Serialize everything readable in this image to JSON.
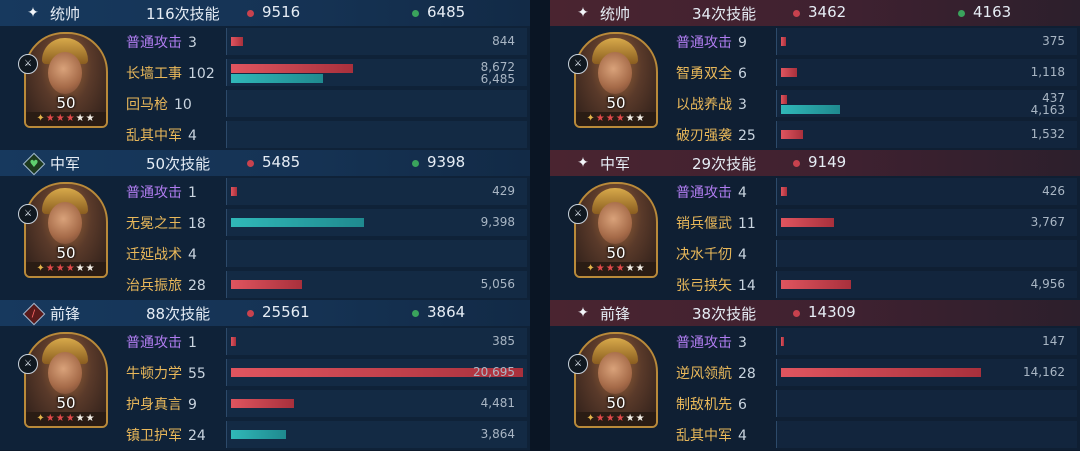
{
  "left": {
    "groups": [
      {
        "role": "统帅",
        "role_icon": "sparkle-icon",
        "casts": "116次技能",
        "damage": "9516",
        "heal": "6485",
        "level": "50",
        "skills": [
          {
            "name": "普通攻击",
            "count": "3",
            "damage": 844,
            "heal": null,
            "damage_label": "844",
            "heal_label": ""
          },
          {
            "name": "长墙工事",
            "count": "102",
            "damage": 8672,
            "heal": 6485,
            "damage_label": "8,672",
            "heal_label": "6,485"
          },
          {
            "name": "回马枪",
            "count": "10",
            "damage": null,
            "heal": null,
            "damage_label": "",
            "heal_label": ""
          },
          {
            "name": "乱其中军",
            "count": "4",
            "damage": null,
            "heal": null,
            "damage_label": "",
            "heal_label": ""
          }
        ]
      },
      {
        "role": "中军",
        "role_icon": "heart-shield-icon",
        "casts": "50次技能",
        "damage": "5485",
        "heal": "9398",
        "level": "50",
        "skills": [
          {
            "name": "普通攻击",
            "count": "1",
            "damage": 429,
            "heal": null,
            "damage_label": "429",
            "heal_label": ""
          },
          {
            "name": "无冕之王",
            "count": "18",
            "damage": null,
            "heal": 9398,
            "damage_label": "",
            "heal_label": "9,398"
          },
          {
            "name": "迁延战术",
            "count": "4",
            "damage": null,
            "heal": null,
            "damage_label": "",
            "heal_label": ""
          },
          {
            "name": "治兵振旅",
            "count": "28",
            "damage": 5056,
            "heal": null,
            "damage_label": "5,056",
            "heal_label": ""
          }
        ]
      },
      {
        "role": "前锋",
        "role_icon": "sword-icon",
        "casts": "88次技能",
        "damage": "25561",
        "heal": "3864",
        "level": "50",
        "skills": [
          {
            "name": "普通攻击",
            "count": "1",
            "damage": 385,
            "heal": null,
            "damage_label": "385",
            "heal_label": ""
          },
          {
            "name": "牛顿力学",
            "count": "55",
            "damage": 20695,
            "heal": null,
            "damage_label": "20,695",
            "heal_label": ""
          },
          {
            "name": "护身真言",
            "count": "9",
            "damage": 4481,
            "heal": null,
            "damage_label": "4,481",
            "heal_label": ""
          },
          {
            "name": "镇卫护军",
            "count": "24",
            "damage": null,
            "heal": 3864,
            "damage_label": "",
            "heal_label": "3,864"
          }
        ]
      }
    ]
  },
  "right": {
    "groups": [
      {
        "role": "统帅",
        "role_icon": "sparkle-icon",
        "casts": "34次技能",
        "damage": "3462",
        "heal": "4163",
        "level": "50",
        "skills": [
          {
            "name": "普通攻击",
            "count": "9",
            "damage": 375,
            "heal": null,
            "damage_label": "375",
            "heal_label": ""
          },
          {
            "name": "智勇双全",
            "count": "6",
            "damage": 1118,
            "heal": null,
            "damage_label": "1,118",
            "heal_label": ""
          },
          {
            "name": "以战养战",
            "count": "3",
            "damage": 437,
            "heal": 4163,
            "damage_label": "437",
            "heal_label": "4,163"
          },
          {
            "name": "破刃强袭",
            "count": "25",
            "damage": 1532,
            "heal": null,
            "damage_label": "1,532",
            "heal_label": ""
          }
        ]
      },
      {
        "role": "中军",
        "role_icon": "sparkle-icon",
        "casts": "29次技能",
        "damage": "9149",
        "heal": "",
        "level": "50",
        "skills": [
          {
            "name": "普通攻击",
            "count": "4",
            "damage": 426,
            "heal": null,
            "damage_label": "426",
            "heal_label": ""
          },
          {
            "name": "销兵偃武",
            "count": "11",
            "damage": 3767,
            "heal": null,
            "damage_label": "3,767",
            "heal_label": ""
          },
          {
            "name": "决水千仞",
            "count": "4",
            "damage": null,
            "heal": null,
            "damage_label": "",
            "heal_label": ""
          },
          {
            "name": "张弓挟矢",
            "count": "14",
            "damage": 4956,
            "heal": null,
            "damage_label": "4,956",
            "heal_label": ""
          }
        ]
      },
      {
        "role": "前锋",
        "role_icon": "sparkle-icon",
        "casts": "38次技能",
        "damage": "14309",
        "heal": "",
        "level": "50",
        "skills": [
          {
            "name": "普通攻击",
            "count": "3",
            "damage": 147,
            "heal": null,
            "damage_label": "147",
            "heal_label": ""
          },
          {
            "name": "逆风领航",
            "count": "28",
            "damage": 14162,
            "heal": null,
            "damage_label": "14,162",
            "heal_label": ""
          },
          {
            "name": "制敌机先",
            "count": "6",
            "damage": null,
            "heal": null,
            "damage_label": "",
            "heal_label": ""
          },
          {
            "name": "乱其中军",
            "count": "4",
            "damage": null,
            "heal": null,
            "damage_label": "",
            "heal_label": ""
          }
        ]
      }
    ]
  },
  "scale_max": 20695,
  "colors": {
    "damage": "#c8424e",
    "heal": "#2aa8a8",
    "healDot": "#3aa35c"
  }
}
